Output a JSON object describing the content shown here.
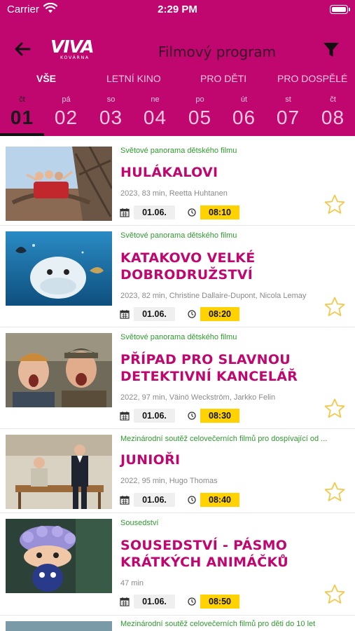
{
  "status": {
    "carrier": "Carrier",
    "time": "2:29 PM"
  },
  "header": {
    "logo": "VIVA",
    "logo_sub": "KOVÁRNA",
    "title": "Filmový program"
  },
  "tabs": [
    {
      "label": "VŠE",
      "active": true
    },
    {
      "label": "LETNÍ KINO",
      "active": false
    },
    {
      "label": "PRO DĚTI",
      "active": false
    },
    {
      "label": "PRO DOSPĚLÉ",
      "active": false
    }
  ],
  "days": [
    {
      "name": "čt",
      "num": "01",
      "active": true
    },
    {
      "name": "pá",
      "num": "02",
      "active": false
    },
    {
      "name": "so",
      "num": "03",
      "active": false
    },
    {
      "name": "ne",
      "num": "04",
      "active": false
    },
    {
      "name": "po",
      "num": "05",
      "active": false
    },
    {
      "name": "út",
      "num": "06",
      "active": false
    },
    {
      "name": "st",
      "num": "07",
      "active": false
    },
    {
      "name": "čt",
      "num": "08",
      "active": false
    }
  ],
  "movies": [
    {
      "section": "Světové panorama dětského filmu",
      "title": "HULÁKALOVI",
      "meta": "2023, 83 min, Reetta Huhtanen",
      "date": "01.06.",
      "time": "08:10"
    },
    {
      "section": "Světové panorama dětského filmu",
      "title": "KATAKOVO VELKÉ DOBRODRUŽSTVÍ",
      "meta": "2023, 82 min, Christine Dallaire-Dupont, Nicola Lemay",
      "date": "01.06.",
      "time": "08:20"
    },
    {
      "section": "Světové panorama dětského filmu",
      "title": "PŘÍPAD PRO SLAVNOU DETEKTIVNÍ KANCELÁŘ",
      "meta": "2022, 97 min, Väinö Weckström, Jarkko Felin",
      "date": "01.06.",
      "time": "08:30"
    },
    {
      "section": "Mezinárodní soutěž celovečerních filmů pro dospívající od ...",
      "title": "JUNIOŘI",
      "meta": "2022, 95 min, Hugo Thomas",
      "date": "01.06.",
      "time": "08:40"
    },
    {
      "section": "Sousedství",
      "title": "SOUSEDSTVÍ - PÁSMO KRÁTKÝCH ANIMÁČKŮ",
      "meta": "47 min",
      "date": "01.06.",
      "time": "08:50"
    },
    {
      "section": "Mezinárodní soutěž celovečerních filmů pro děti do 10 let"
    }
  ],
  "colors": {
    "brand": "#c0066f",
    "section": "#2e9a2e",
    "time_bg": "#ffd200",
    "star": "#f2c94c"
  }
}
